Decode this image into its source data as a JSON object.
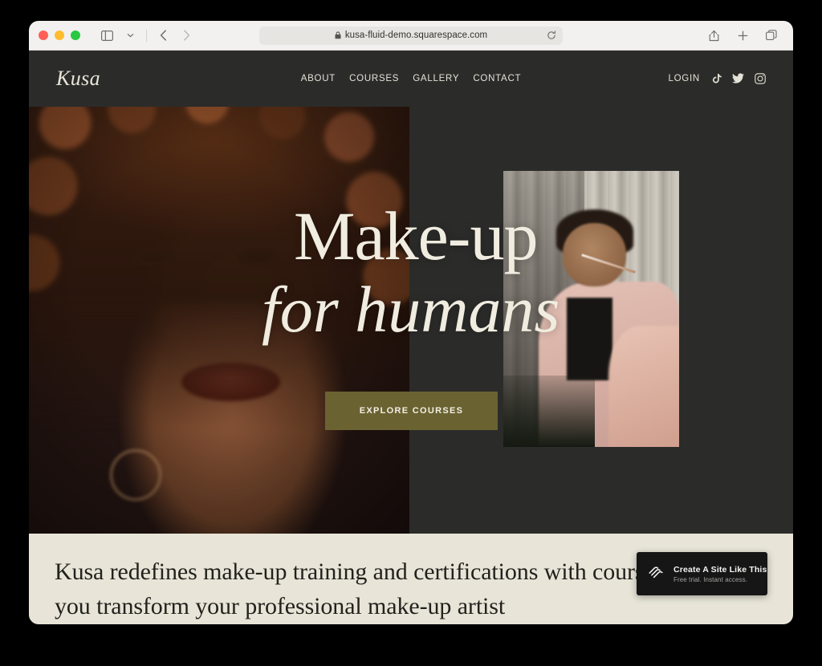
{
  "browser": {
    "traffic_lights": [
      "close",
      "minimize",
      "zoom"
    ],
    "sidebar_toggle": "sidebar-icon",
    "tab_overview_chevron": "chevron-down-icon",
    "back_label": "back-icon",
    "forward_label": "forward-icon",
    "url": "kusa-fluid-demo.squarespace.com",
    "lock": "lock-icon",
    "reload": "reload-icon",
    "share": "share-icon",
    "new_tab": "plus-icon",
    "tabs": "tabs-icon"
  },
  "site": {
    "brand": "Kusa",
    "nav": [
      {
        "label": "ABOUT"
      },
      {
        "label": "COURSES"
      },
      {
        "label": "GALLERY"
      },
      {
        "label": "CONTACT"
      }
    ],
    "login_label": "LOGIN",
    "social": [
      {
        "name": "tiktok-icon"
      },
      {
        "name": "twitter-icon"
      },
      {
        "name": "instagram-icon"
      }
    ],
    "hero": {
      "headline_line1": "Make-up",
      "headline_line2": "for humans",
      "cta_label": "EXPLORE COURSES",
      "left_image_alt": "portrait-curly-hair-model",
      "right_image_alt": "makeup-artist-applying-eyeshadow"
    },
    "intro": {
      "text": "Kusa redefines make-up training and certifications with courses to help you transform your professional make-up artist"
    }
  },
  "badge": {
    "logo": "squarespace-logo-icon",
    "title": "Create A Site Like This",
    "subtitle": "Free trial. Instant access."
  },
  "colors": {
    "page_background": "#000000",
    "site_dark": "#2b2b2a",
    "cream": "#e8e5d8",
    "accent_olive": "#6a6231",
    "text_cream": "#e9e6d9",
    "badge_dark": "#161616"
  }
}
